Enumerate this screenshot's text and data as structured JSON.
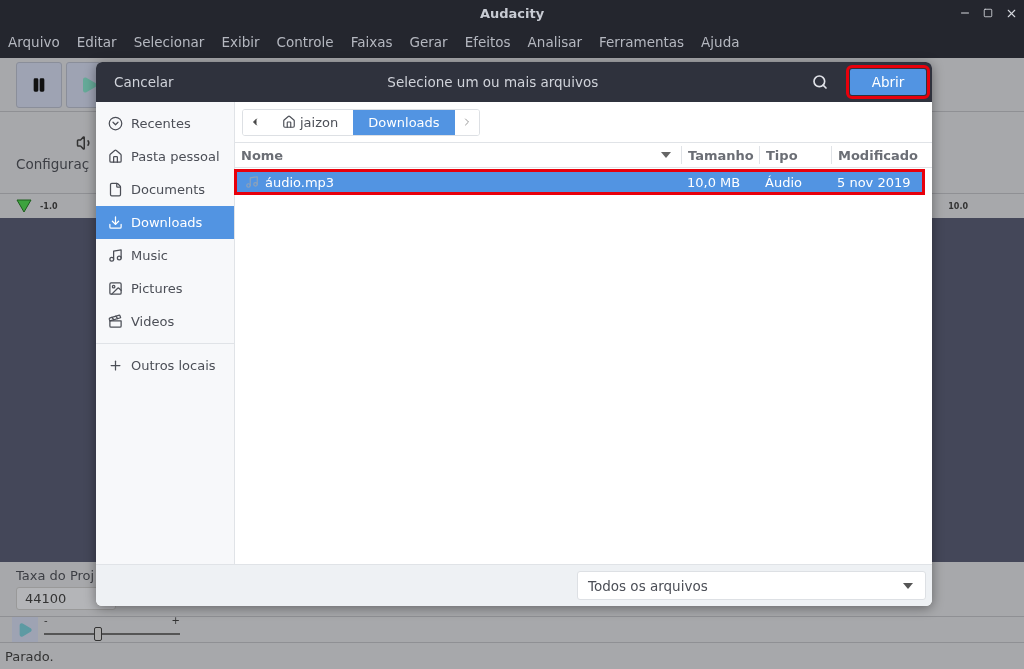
{
  "window": {
    "title": "Audacity"
  },
  "menu": [
    "Arquivo",
    "Editar",
    "Selecionar",
    "Exibir",
    "Controle",
    "Faixas",
    "Gerar",
    "Efeitos",
    "Analisar",
    "Ferramentas",
    "Ajuda"
  ],
  "audio_setup": {
    "label": "Configuraç"
  },
  "ruler": {
    "start": "-1.0",
    "end": "10.0"
  },
  "project_rate": {
    "label": "Taxa do Proj",
    "value": "44100"
  },
  "play_speed": {
    "level": 0.4,
    "minus": "-",
    "plus": "+"
  },
  "status_bar": "Parado.",
  "dialog": {
    "cancel": "Cancelar",
    "title": "Selecione um ou mais arquivos",
    "open_button": {
      "label": "Abrir",
      "highlighted": true
    },
    "path": [
      {
        "label": "jaizon",
        "kind": "home",
        "selected": false
      },
      {
        "label": "Downloads",
        "kind": "folder",
        "selected": true
      }
    ],
    "places": [
      {
        "label": "Recentes",
        "kind": "recent",
        "selected": false
      },
      {
        "label": "Pasta pessoal",
        "kind": "home",
        "selected": false
      },
      {
        "label": "Documents",
        "kind": "documents",
        "selected": false
      },
      {
        "label": "Downloads",
        "kind": "downloads",
        "selected": true
      },
      {
        "label": "Music",
        "kind": "music",
        "selected": false
      },
      {
        "label": "Pictures",
        "kind": "pictures",
        "selected": false
      },
      {
        "label": "Videos",
        "kind": "videos",
        "selected": false
      },
      {
        "label": "Outros locais",
        "kind": "other",
        "selected": false
      }
    ],
    "columns": [
      "Nome",
      "Tamanho",
      "Tipo",
      "Modificado"
    ],
    "rows": [
      {
        "name": "áudio.mp3",
        "size": "10,0 MB",
        "type": "Áudio",
        "modified": "5 nov 2019",
        "selected": true,
        "highlighted": true
      }
    ],
    "filter": "Todos os arquivos"
  }
}
